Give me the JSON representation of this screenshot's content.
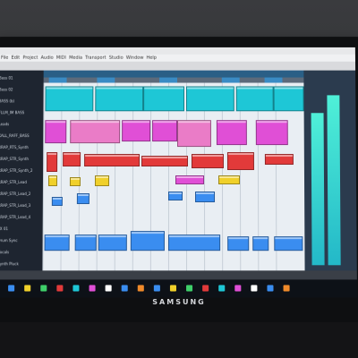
{
  "scene": {
    "brand": "SAMSUNG"
  },
  "daw": {
    "menu_items": [
      "File",
      "Edit",
      "Project",
      "Audio",
      "MIDI",
      "Media",
      "Transport",
      "Studio",
      "Window",
      "Help"
    ],
    "tracks": [
      "Bass 01",
      "Bass 02",
      "BASS (b)",
      "FLLM_IM BASS",
      "Leads",
      "KALL_RAFF_BASS",
      "RRAP_RTS_Synth",
      "RRAP_STR_Synth",
      "RRAP_STR_Synth_2",
      "RRAP_STR_Lead",
      "RRAP_STR_Lead_2",
      "RRAP_STR_Lead_3",
      "RRAP_STR_Lead_4",
      "FX 01",
      "Drum Sync",
      "Vocals",
      "Synth Pluck"
    ],
    "colors": {
      "cyan": "#1ec7d6",
      "magenta": "#e04fd6",
      "pink": "#ea7cc7",
      "red": "#e23a3a",
      "yellow": "#f0d02a",
      "blue": "#3a8df0",
      "green": "#3fd06a"
    }
  }
}
